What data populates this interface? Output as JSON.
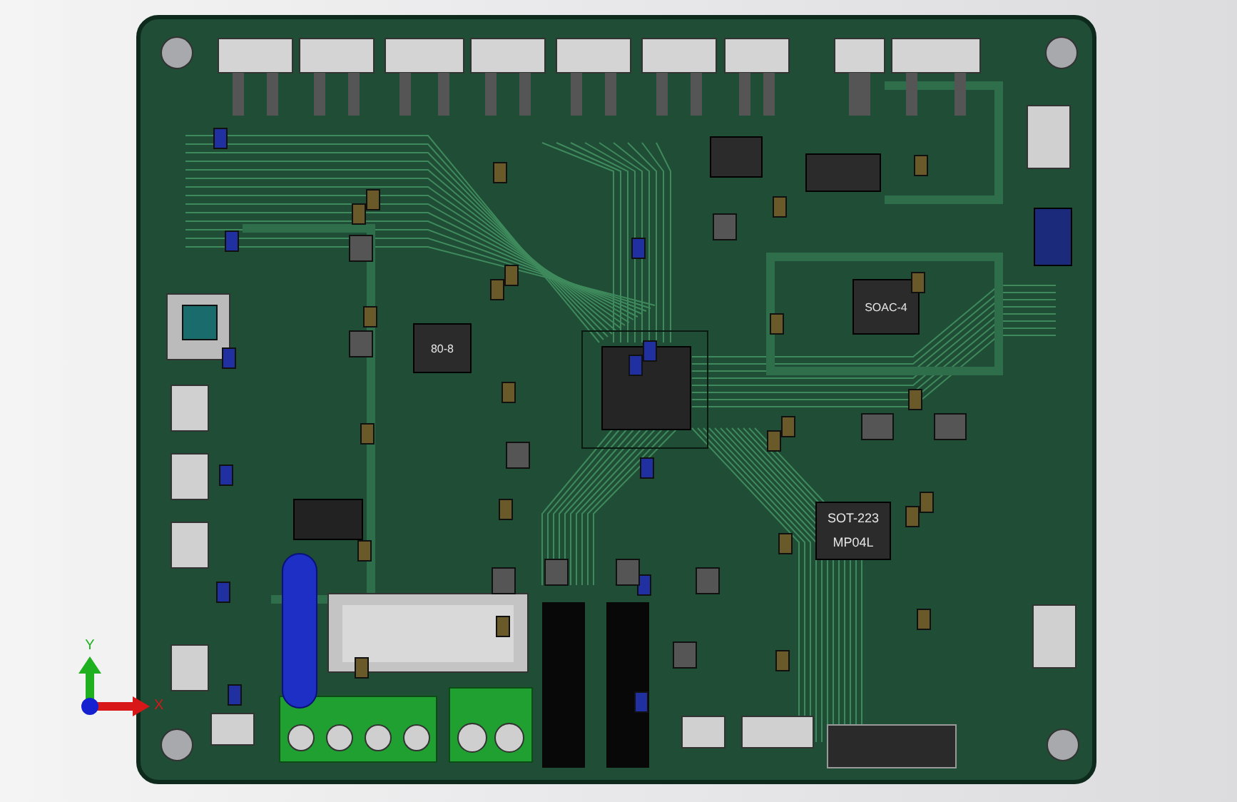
{
  "chip_labels": [
    {
      "text": "80-8",
      "kind": "soic"
    },
    {
      "text": "SOAC-4",
      "kind": "soic"
    },
    {
      "text": "SOT-223",
      "kind": "sot"
    },
    {
      "text": "MP04L",
      "kind": "sot"
    }
  ],
  "axis": {
    "y_label": "Y",
    "x_label": "X"
  }
}
